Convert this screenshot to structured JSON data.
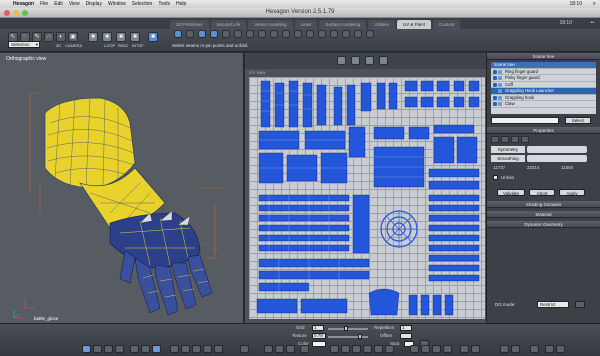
{
  "menubar": {
    "app": "Hexagon",
    "items": [
      "File",
      "Edit",
      "View",
      "Display",
      "Window",
      "Selection",
      "Tools",
      "Help"
    ],
    "clock": "18:10"
  },
  "window": {
    "title": "Hexagon Version 2.5.1.79"
  },
  "tabs": [
    {
      "label": "3D Primitives",
      "active": false
    },
    {
      "label": "Second Life",
      "active": false
    },
    {
      "label": "Vertex modeling",
      "active": false
    },
    {
      "label": "Lines",
      "active": false
    },
    {
      "label": "Surface modeling",
      "active": false
    },
    {
      "label": "Utilities",
      "active": false
    },
    {
      "label": "UV & Paint",
      "active": true
    },
    {
      "label": "Custom",
      "active": false
    }
  ],
  "tabstrip": {
    "time": "18:10"
  },
  "toolbar": {
    "selection_label": "Selection",
    "mode_labels": [
      "LOOP",
      "RING",
      "INTSF"
    ],
    "small_labels": [
      "3D",
      "CAMERA"
    ],
    "hint": "Select seams or pin points and unfold."
  },
  "viewport_left": {
    "title": "Orthographic view",
    "object_label": "battle_glove"
  },
  "uv_view": {
    "title": "UV view"
  },
  "scene": {
    "header": "Scene tree",
    "items": [
      {
        "label": "Scene tree",
        "selected": false,
        "header": true
      },
      {
        "label": "Ring finger guard",
        "selected": false
      },
      {
        "label": "Pinky finger guard",
        "selected": false
      },
      {
        "label": "Cuff",
        "selected": false
      },
      {
        "label": "Grappling Hook Launcher",
        "selected": true
      },
      {
        "label": "Grappling hook",
        "selected": false
      },
      {
        "label": "Claw",
        "selected": false
      }
    ],
    "select_button": "Select"
  },
  "properties": {
    "header": "Properties",
    "symmetry_label": "Symmetry",
    "smoothing_label": "Smoothing",
    "stats": [
      "11737",
      "23314",
      "11594"
    ],
    "unfold_label": "Unfold",
    "buttons": [
      "Validate",
      "Abort",
      "Apply"
    ]
  },
  "panels": {
    "shading": "Shading Domains",
    "material": "Material",
    "dynamic": "Dynamic Geometry"
  },
  "dg_mode": {
    "label": "DG mode:",
    "value": "Restrict"
  },
  "bottom": {
    "grid_label": "Grid",
    "grid_value": "1",
    "texture_label": "Texture",
    "texture_value": "0.79",
    "repetition_label": "Repetition",
    "repetition_value": "1",
    "offset_label": "Offset",
    "color_label": "Color",
    "spot_label": "Spot"
  },
  "colors": {
    "accent": "#2f62b0",
    "uv_blue": "#2356d8",
    "mesh_yellow": "#e8d22b"
  }
}
